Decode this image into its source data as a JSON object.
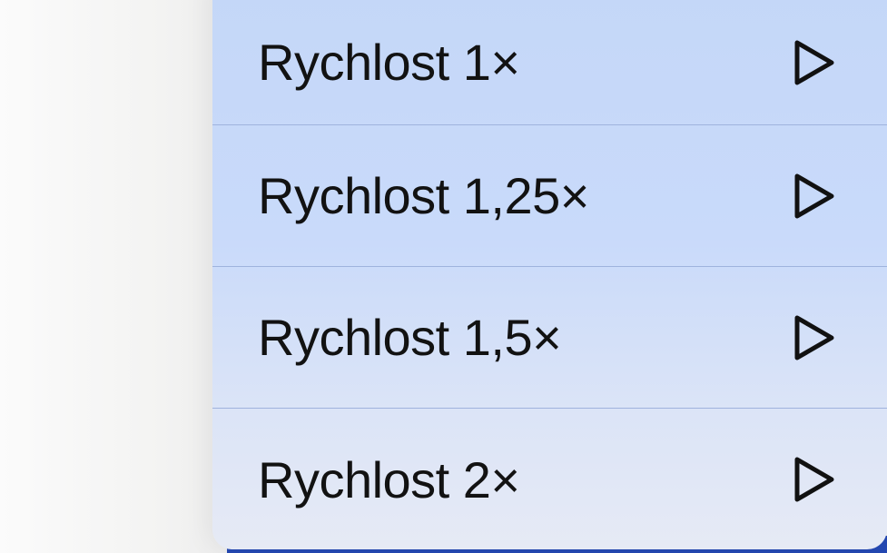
{
  "speed_menu": {
    "items": [
      {
        "label": "Rychlost 1×",
        "icon": "play-icon"
      },
      {
        "label": "Rychlost 1,25×",
        "icon": "play-icon"
      },
      {
        "label": "Rychlost 1,5×",
        "icon": "play-icon"
      },
      {
        "label": "Rychlost 2×",
        "icon": "play-icon"
      }
    ]
  },
  "colors": {
    "menu_background": "#c9dafa",
    "separator": "#9fb3dd",
    "text": "#121212",
    "accent_strip": "#2448b2"
  }
}
